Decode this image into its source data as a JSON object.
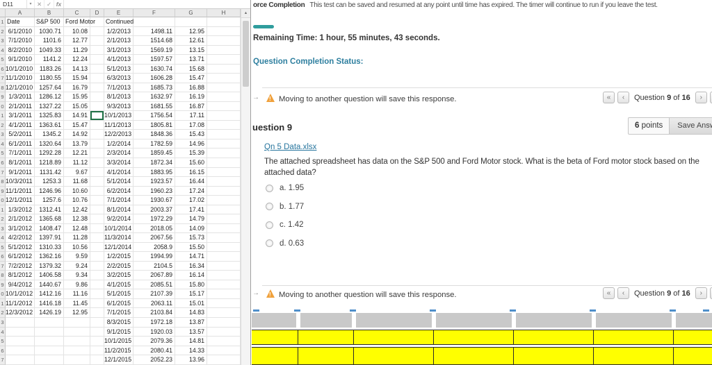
{
  "colors": {
    "timer_bar": "#2f9d9d",
    "status_heading": "#2e7f9f",
    "link": "#27759e",
    "warning_triangle": "#f0a13c",
    "highlight_row": "#ffff00",
    "selected_cell_border": "#1f7145"
  },
  "spreadsheet": {
    "name_box": "D11",
    "formula_bar": {
      "dropdown_icon": "▾",
      "cancel_icon": "✕",
      "enter_icon": "✓",
      "fx_icon": "fx"
    },
    "scroll_up_icon": "▲",
    "column_letters": [
      "A",
      "B",
      "C",
      "D",
      "E",
      "F",
      "G",
      "H"
    ],
    "total_rows": 37,
    "headers": {
      "date": "Date",
      "sp500": "S&P 500",
      "ford": "Ford Motor",
      "continued": "Continued"
    },
    "left_rows": [
      [
        "6/1/2010",
        "1030.71",
        "10.08"
      ],
      [
        "7/1/2010",
        "1101.6",
        "12.77"
      ],
      [
        "8/2/2010",
        "1049.33",
        "11.29"
      ],
      [
        "9/1/2010",
        "1141.2",
        "12.24"
      ],
      [
        "10/1/2010",
        "1183.26",
        "14.13"
      ],
      [
        "11/1/2010",
        "1180.55",
        "15.94"
      ],
      [
        "12/1/2010",
        "1257.64",
        "16.79"
      ],
      [
        "1/3/2011",
        "1286.12",
        "15.95"
      ],
      [
        "2/1/2011",
        "1327.22",
        "15.05"
      ],
      [
        "3/1/2011",
        "1325.83",
        "14.91"
      ],
      [
        "4/1/2011",
        "1363.61",
        "15.47"
      ],
      [
        "5/2/2011",
        "1345.2",
        "14.92"
      ],
      [
        "6/1/2011",
        "1320.64",
        "13.79"
      ],
      [
        "7/1/2011",
        "1292.28",
        "12.21"
      ],
      [
        "8/1/2011",
        "1218.89",
        "11.12"
      ],
      [
        "9/1/2011",
        "1131.42",
        "9.67"
      ],
      [
        "10/3/2011",
        "1253.3",
        "11.68"
      ],
      [
        "11/1/2011",
        "1246.96",
        "10.60"
      ],
      [
        "12/1/2011",
        "1257.6",
        "10.76"
      ],
      [
        "1/3/2012",
        "1312.41",
        "12.42"
      ],
      [
        "2/1/2012",
        "1365.68",
        "12.38"
      ],
      [
        "3/1/2012",
        "1408.47",
        "12.48"
      ],
      [
        "4/2/2012",
        "1397.91",
        "11.28"
      ],
      [
        "5/1/2012",
        "1310.33",
        "10.56"
      ],
      [
        "6/1/2012",
        "1362.16",
        "9.59"
      ],
      [
        "7/2/2012",
        "1379.32",
        "9.24"
      ],
      [
        "8/1/2012",
        "1406.58",
        "9.34"
      ],
      [
        "9/4/2012",
        "1440.67",
        "9.86"
      ],
      [
        "10/1/2012",
        "1412.16",
        "11.16"
      ],
      [
        "11/1/2012",
        "1416.18",
        "11.45"
      ],
      [
        "12/3/2012",
        "1426.19",
        "12.95"
      ]
    ],
    "continued_rows": [
      [
        "1/2/2013",
        "1498.11",
        "12.95"
      ],
      [
        "2/1/2013",
        "1514.68",
        "12.61"
      ],
      [
        "3/1/2013",
        "1569.19",
        "13.15"
      ],
      [
        "4/1/2013",
        "1597.57",
        "13.71"
      ],
      [
        "5/1/2013",
        "1630.74",
        "15.68"
      ],
      [
        "6/3/2013",
        "1606.28",
        "15.47"
      ],
      [
        "7/1/2013",
        "1685.73",
        "16.88"
      ],
      [
        "8/1/2013",
        "1632.97",
        "16.19"
      ],
      [
        "9/3/2013",
        "1681.55",
        "16.87"
      ],
      [
        "10/1/2013",
        "1756.54",
        "17.11"
      ],
      [
        "11/1/2013",
        "1805.81",
        "17.08"
      ],
      [
        "12/2/2013",
        "1848.36",
        "15.43"
      ],
      [
        "1/2/2014",
        "1782.59",
        "14.96"
      ],
      [
        "2/3/2014",
        "1859.45",
        "15.39"
      ],
      [
        "3/3/2014",
        "1872.34",
        "15.60"
      ],
      [
        "4/1/2014",
        "1883.95",
        "16.15"
      ],
      [
        "5/1/2014",
        "1923.57",
        "16.44"
      ],
      [
        "6/2/2014",
        "1960.23",
        "17.24"
      ],
      [
        "7/1/2014",
        "1930.67",
        "17.02"
      ],
      [
        "8/1/2014",
        "2003.37",
        "17.41"
      ],
      [
        "9/2/2014",
        "1972.29",
        "14.79"
      ],
      [
        "10/1/2014",
        "2018.05",
        "14.09"
      ],
      [
        "11/3/2014",
        "2067.56",
        "15.73"
      ],
      [
        "12/1/2014",
        "2058.9",
        "15.50"
      ],
      [
        "1/2/2015",
        "1994.99",
        "14.71"
      ],
      [
        "2/2/2015",
        "2104.5",
        "16.34"
      ],
      [
        "3/2/2015",
        "2067.89",
        "16.14"
      ],
      [
        "4/1/2015",
        "2085.51",
        "15.80"
      ],
      [
        "5/1/2015",
        "2107.39",
        "15.17"
      ],
      [
        "6/1/2015",
        "2063.11",
        "15.01"
      ],
      [
        "7/1/2015",
        "2103.84",
        "14.83"
      ],
      [
        "8/3/2015",
        "1972.18",
        "13.87"
      ],
      [
        "9/1/2015",
        "1920.03",
        "13.57"
      ],
      [
        "10/1/2015",
        "2079.36",
        "14.81"
      ],
      [
        "11/2/2015",
        "2080.41",
        "14.33"
      ],
      [
        "12/1/2015",
        "2052.23",
        "13.96"
      ]
    ]
  },
  "test": {
    "instructions_bold": "orce Completion",
    "instructions_text": "This test can be saved and resumed at any point until time has expired. The timer will continue to run if you leave the test.",
    "remaining_time_label": "Remaining Time:",
    "remaining_time_value": "1 hour, 55 minutes, 43 seconds.",
    "completion_status_heading": "Question Completion Status:",
    "arrow_icon": "→",
    "warning_mark": "!",
    "save_warning": "Moving to another question will save this response.",
    "nav": {
      "first_icon": "«",
      "prev_icon": "‹",
      "label_question": "Question",
      "current": "9",
      "label_of": "of",
      "total": "16",
      "next_icon": "›",
      "last_icon": "»"
    },
    "question_title": "uestion 9",
    "points": "6",
    "points_label": "points",
    "save_answer_label": "Save Answer",
    "attachment": "Qn 5 Data.xlsx",
    "question_text": "The attached spreadsheet has data on the S&P 500 and Ford Motor stock.  What is the beta of Ford motor stock based on the attached data?",
    "options": [
      {
        "label": "a. 1.95"
      },
      {
        "label": "b. 1.77"
      },
      {
        "label": "c. 1.42"
      },
      {
        "label": "d. 0.63"
      }
    ]
  }
}
